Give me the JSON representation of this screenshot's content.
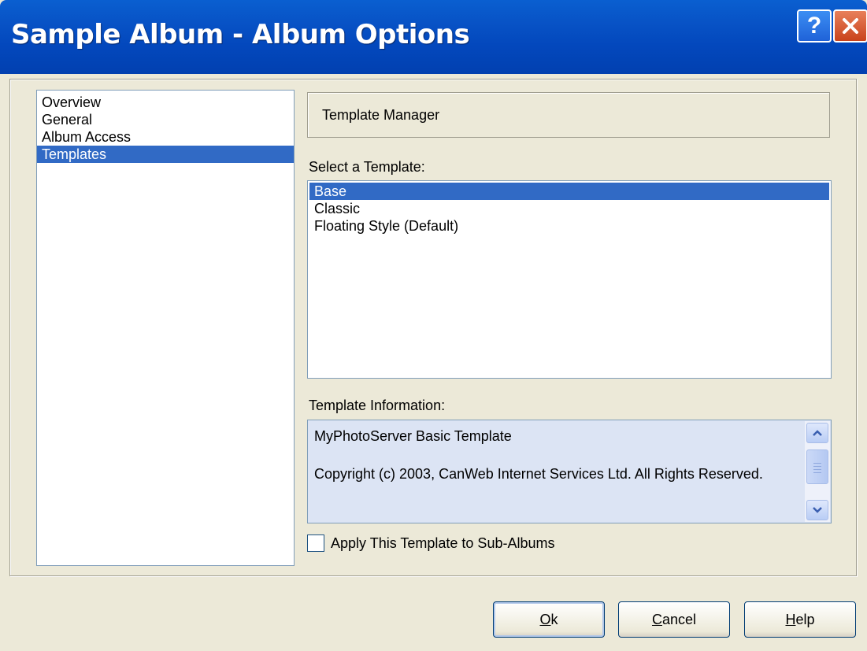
{
  "window": {
    "title": "Sample Album - Album Options",
    "help_glyph": "?",
    "close_icon": "close-icon"
  },
  "categories": {
    "items": [
      {
        "label": "Overview"
      },
      {
        "label": "General"
      },
      {
        "label": "Album Access"
      },
      {
        "label": "Templates"
      }
    ],
    "selected_index": 3
  },
  "panel": {
    "header": "Template Manager",
    "select_label": "Select a Template:",
    "templates": [
      {
        "label": "Base"
      },
      {
        "label": "Classic"
      },
      {
        "label": "Floating Style (Default)"
      }
    ],
    "selected_template_index": 0,
    "info_label": "Template Information:",
    "info_lines": [
      "MyPhotoServer Basic Template",
      "Copyright (c) 2003, CanWeb Internet Services Ltd. All Rights Reserved."
    ],
    "apply_checkbox": {
      "label": "Apply This Template to Sub-Albums",
      "checked": false
    }
  },
  "buttons": {
    "ok": {
      "mnemonic": "O",
      "rest": "k"
    },
    "cancel": {
      "mnemonic": "C",
      "rest": "ancel"
    },
    "help": {
      "mnemonic": "H",
      "rest": "elp"
    }
  },
  "colors": {
    "title_bar": "#0348bd",
    "selection": "#316ac5",
    "dialog_bg": "#ece9d8",
    "info_bg": "#dce4f4",
    "close_button": "#c9431c"
  }
}
